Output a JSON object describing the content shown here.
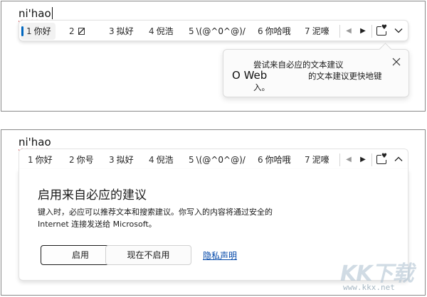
{
  "top_panel": {
    "typed_text": "ni'hao",
    "candidates": [
      {
        "num": "1",
        "text": "你好"
      },
      {
        "num": "2",
        "text": ""
      },
      {
        "num": "3",
        "text": "拟好"
      },
      {
        "num": "4",
        "text": "倪浩"
      },
      {
        "num": "5",
        "text": "\\(@^0^@)/"
      },
      {
        "num": "6",
        "text": "你哈哦"
      },
      {
        "num": "7",
        "text": "泥嚎"
      }
    ],
    "tooltip": {
      "line1": "尝试来自必应的文本建议",
      "big": "O Web",
      "line2": "的文本建议更快地键",
      "line3": "入。"
    }
  },
  "bottom_panel": {
    "typed_text": "ni'hao",
    "candidates": [
      {
        "num": "1",
        "text": "你好"
      },
      {
        "num": "2",
        "text": "你号"
      },
      {
        "num": "3",
        "text": "拟好"
      },
      {
        "num": "4",
        "text": "倪浩"
      },
      {
        "num": "5",
        "text": "\\(@^0^@)/"
      },
      {
        "num": "6",
        "text": "你哈哦"
      },
      {
        "num": "7",
        "text": "泥嚎"
      }
    ],
    "card": {
      "title": "启用来自必应的建议",
      "body_line1": "键入时，必应可以推荐文本和搜索建议。你写入的内容将通过安全的",
      "body_line2": "Internet 连接发送给 Microsoft。",
      "enable_label": "启用",
      "not_now_label": "现在不启用",
      "privacy_label": "隐私声明"
    }
  },
  "watermark": {
    "text": "KK下载",
    "url": "www.kkx.net"
  },
  "colors": {
    "accent": "#0067c0",
    "link": "#0046a8",
    "spell_underline": "#d13438"
  }
}
